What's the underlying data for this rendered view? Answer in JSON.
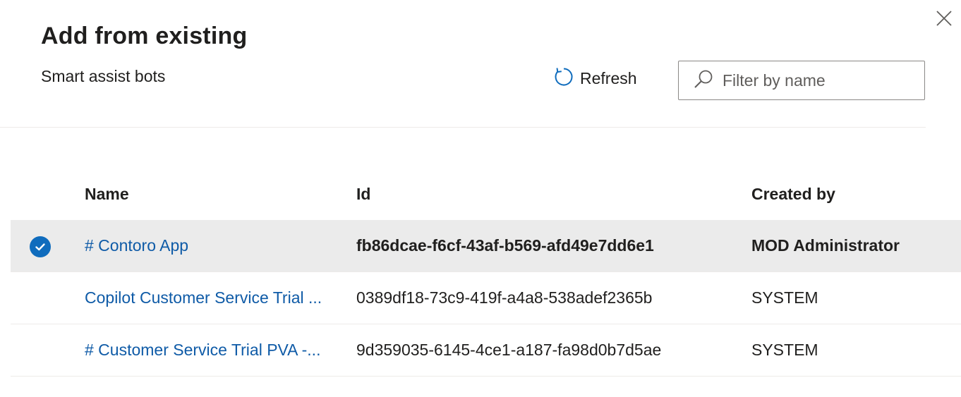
{
  "dialog": {
    "title": "Add from existing",
    "subtitle": "Smart assist bots",
    "close_icon": "close-icon"
  },
  "toolbar": {
    "refresh_label": "Refresh",
    "refresh_icon": "refresh-icon",
    "filter_placeholder": "Filter by name",
    "filter_value": "",
    "search_icon": "search-icon"
  },
  "table": {
    "columns": [
      "Name",
      "Id",
      "Created by"
    ],
    "rows": [
      {
        "name": "# Contoro App",
        "id": "fb86dcae-f6cf-43af-b569-afd49e7dd6e1",
        "created_by": "MOD Administrator",
        "selected": true
      },
      {
        "name": "Copilot Customer Service Trial ...",
        "id": "0389df18-73c9-419f-a4a8-538adef2365b",
        "created_by": "SYSTEM",
        "selected": false
      },
      {
        "name": "# Customer Service Trial PVA -...",
        "id": "9d359035-6145-4ce1-a187-fa98d0b7d5ae",
        "created_by": "SYSTEM",
        "selected": false
      }
    ]
  },
  "colors": {
    "accent": "#0f6cbd",
    "link": "#0f5ba7",
    "selected_row": "#ebebeb"
  }
}
